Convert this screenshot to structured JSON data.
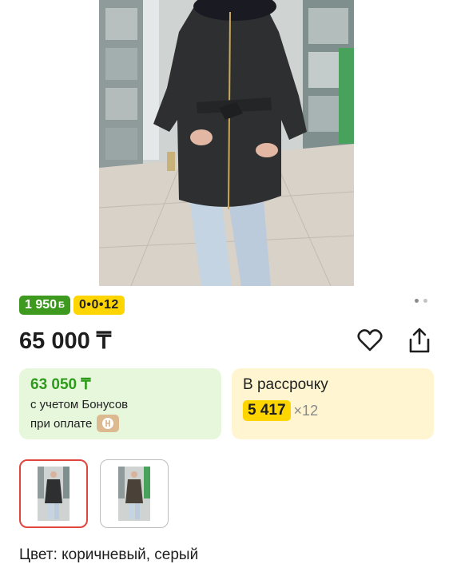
{
  "product": {
    "photo_alt": "product-photo"
  },
  "pager": {
    "count": 2,
    "active": 0
  },
  "badges": {
    "bonus_value": "1 950",
    "bonus_unit": "Б",
    "installment_code": "0•0•12"
  },
  "price": "65 000 ₸",
  "bonus_card": {
    "price": "63 050 ₸",
    "line1": "с учетом Бонусов",
    "line2": "при оплате"
  },
  "installment_card": {
    "title": "В рассрочку",
    "amount": "5 417",
    "months": "×12"
  },
  "color_info": "Цвет: коричневый, серый",
  "colors": {
    "bonus_green": "#3d9a1f",
    "yellow": "#ffd500",
    "selected_border": "#e1453d"
  }
}
